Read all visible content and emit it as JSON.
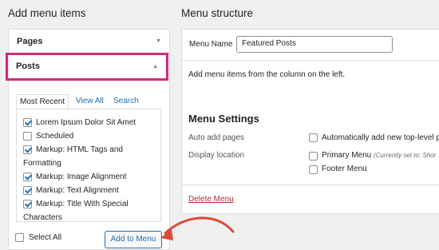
{
  "left": {
    "title": "Add menu items",
    "accordion": [
      {
        "label": "Pages",
        "arrow": "▼"
      },
      {
        "label": "Posts",
        "arrow": "▲"
      }
    ],
    "tabs": [
      "Most Recent",
      "View All",
      "Search"
    ],
    "items": [
      {
        "label_lines": [
          "Lorem Ipsum Dolor Sit Amet"
        ],
        "checked": true
      },
      {
        "label_lines": [
          "Scheduled"
        ],
        "checked": false
      },
      {
        "label_lines": [
          "Markup: HTML Tags and",
          "Formatting"
        ],
        "checked": true
      },
      {
        "label_lines": [
          "Markup: Image Alignment"
        ],
        "checked": true
      },
      {
        "label_lines": [
          "Markup: Text Alignment"
        ],
        "checked": true
      },
      {
        "label_lines": [
          "Markup: Title With Special",
          "Characters"
        ],
        "checked": true
      }
    ],
    "select_all_label": "Select All",
    "add_button_label": "Add to Menu"
  },
  "right": {
    "title": "Menu structure",
    "menu_name_label": "Menu Name",
    "menu_name_value": "Featured Posts",
    "instructions": "Add menu items from the column on the left.",
    "settings_title": "Menu Settings",
    "auto_add_label": "Auto add pages",
    "auto_add_option": "Automatically add new top-level pa",
    "display_location_label": "Display location",
    "primary_menu_label": "Primary Menu",
    "primary_menu_note": "(Currently set to: Shor",
    "footer_menu_label": "Footer Menu",
    "delete_label": "Delete Menu"
  },
  "colors": {
    "highlight": "#d12a7a",
    "arrow": "#dd4a3a",
    "link": "#2271b1"
  }
}
